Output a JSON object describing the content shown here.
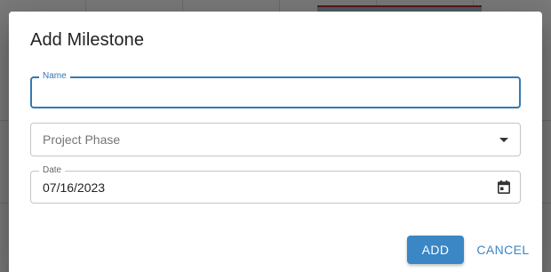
{
  "dialog": {
    "title": "Add Milestone"
  },
  "form": {
    "name": {
      "label": "Name",
      "value": ""
    },
    "project_phase": {
      "placeholder": "Project Phase",
      "icon": "arrow-drop-down-icon"
    },
    "date": {
      "label": "Date",
      "value": "07/16/2023",
      "icon": "calendar-icon"
    }
  },
  "actions": {
    "add_label": "ADD",
    "cancel_label": "CANCEL"
  },
  "colors": {
    "primary": "#3b86c4",
    "focus_border": "#3578b3",
    "scrim": "rgba(0,0,0,0.5)"
  }
}
